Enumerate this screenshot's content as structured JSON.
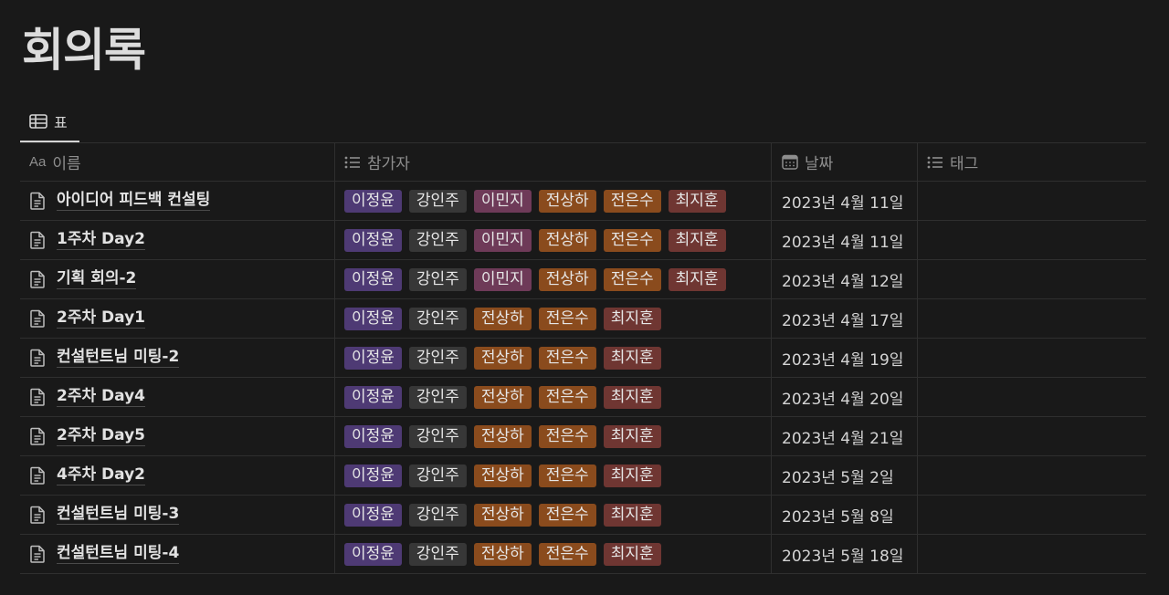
{
  "page": {
    "title": "회의록"
  },
  "view_tab": {
    "label": "표"
  },
  "columns": {
    "name": "이름",
    "participants": "참가자",
    "date": "날짜",
    "tags": "태그",
    "name_icon_text": "Aa"
  },
  "tag_colors": {
    "이정윤": "#4e3a74",
    "강인주": "#373737",
    "이민지": "#6e3a58",
    "전상하": "#8a4b1d",
    "전은수": "#8a4b1d",
    "최지훈": "#6f3632"
  },
  "rows": [
    {
      "name": "아이디어 피드백 컨설팅",
      "participants": [
        "이정윤",
        "강인주",
        "이민지",
        "전상하",
        "전은수",
        "최지훈"
      ],
      "date": "2023년 4월 11일",
      "tags": ""
    },
    {
      "name": "1주차 Day2",
      "participants": [
        "이정윤",
        "강인주",
        "이민지",
        "전상하",
        "전은수",
        "최지훈"
      ],
      "date": "2023년 4월 11일",
      "tags": ""
    },
    {
      "name": "기획 회의-2",
      "participants": [
        "이정윤",
        "강인주",
        "이민지",
        "전상하",
        "전은수",
        "최지훈"
      ],
      "date": "2023년 4월 12일",
      "tags": ""
    },
    {
      "name": "2주차 Day1",
      "participants": [
        "이정윤",
        "강인주",
        "전상하",
        "전은수",
        "최지훈"
      ],
      "date": "2023년 4월 17일",
      "tags": ""
    },
    {
      "name": "컨설턴트님 미팅-2",
      "participants": [
        "이정윤",
        "강인주",
        "전상하",
        "전은수",
        "최지훈"
      ],
      "date": "2023년 4월 19일",
      "tags": ""
    },
    {
      "name": "2주차 Day4",
      "participants": [
        "이정윤",
        "강인주",
        "전상하",
        "전은수",
        "최지훈"
      ],
      "date": "2023년 4월 20일",
      "tags": ""
    },
    {
      "name": "2주차 Day5",
      "participants": [
        "이정윤",
        "강인주",
        "전상하",
        "전은수",
        "최지훈"
      ],
      "date": "2023년 4월 21일",
      "tags": ""
    },
    {
      "name": "4주차 Day2",
      "participants": [
        "이정윤",
        "강인주",
        "전상하",
        "전은수",
        "최지훈"
      ],
      "date": "2023년 5월 2일",
      "tags": ""
    },
    {
      "name": "컨설턴트님 미팅-3",
      "participants": [
        "이정윤",
        "강인주",
        "전상하",
        "전은수",
        "최지훈"
      ],
      "date": "2023년 5월 8일",
      "tags": ""
    },
    {
      "name": "컨설턴트님 미팅-4",
      "participants": [
        "이정윤",
        "강인주",
        "전상하",
        "전은수",
        "최지훈"
      ],
      "date": "2023년 5월 18일",
      "tags": ""
    }
  ],
  "icons": {
    "view_tab": "table-icon",
    "name_column": "text-property-icon",
    "participants_column": "list-icon",
    "date_column": "calendar-icon",
    "tags_column": "list-icon",
    "row": "document-icon"
  }
}
